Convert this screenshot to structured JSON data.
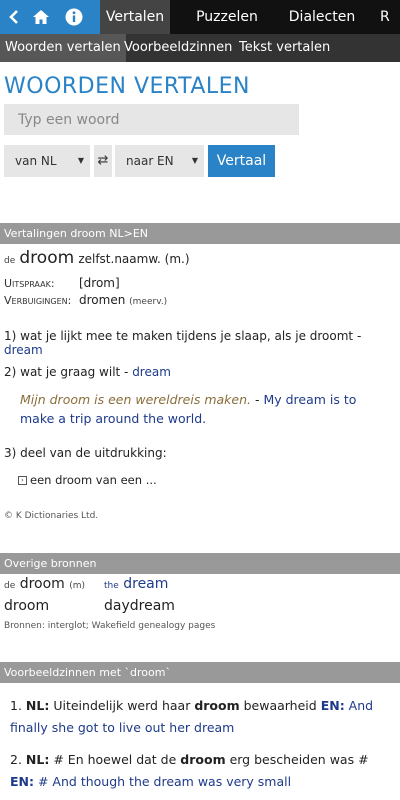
{
  "nav": {
    "back_icon": "chevron-left-icon",
    "home_icon": "home-icon",
    "info_icon": "info-icon",
    "tabs": [
      "Vertalen",
      "Puzzelen",
      "Dialecten",
      "R"
    ]
  },
  "subnav": [
    "Woorden vertalen",
    "Voorbeeldzinnen",
    "Tekst vertalen"
  ],
  "page_title": "WOORDEN VERTALEN",
  "search": {
    "placeholder": "Typ een woord"
  },
  "lang": {
    "from": "van NL",
    "to": "naar EN",
    "translate_button": "Vertaal"
  },
  "translations": {
    "header": "Vertalingen droom NL>EN",
    "article": "de",
    "word": "droom",
    "pos": "zelfst.naamw. (m.)",
    "pron_label": "Uitspraak:",
    "pron_value": "[drom]",
    "infl_label": "Verbuigingen:",
    "infl_value": "dromen",
    "infl_note": "(meerv.)",
    "senses": [
      {
        "text": "1) wat je lijkt mee te maken tijdens je slaap, als je droomt - ",
        "translation": "dream"
      },
      {
        "text": "2) wat je graag wilt - ",
        "translation": "dream"
      }
    ],
    "example_nl": "Mijn droom is een wereldreis maken.",
    "example_sep": " - ",
    "example_en": "My dream is to make a trip around the world.",
    "sense3": "3) deel van de uitdrukking:",
    "expression": "een droom van een ...",
    "copyright": "© K Dictionaries Ltd."
  },
  "other_sources": {
    "header": "Overige bronnen",
    "rows": [
      {
        "left_article": "de",
        "left": "droom",
        "left_note": "(m)",
        "right_article": "the",
        "right": "dream"
      },
      {
        "left_article": "",
        "left": "droom",
        "left_note": "",
        "right_article": "",
        "right": "daydream"
      }
    ],
    "sources": "Bronnen: interglot; Wakefield genealogy pages"
  },
  "example_sentences": {
    "header": "Voorbeeldzinnen met `droom`",
    "items": [
      {
        "num": "1.",
        "nl_label": "NL:",
        "nl_before": "Uiteindelijk werd haar ",
        "nl_bold": "droom",
        "nl_after": " bewaarheid ",
        "en_label": "EN:",
        "en": "And finally she got to live out her dream"
      },
      {
        "num": "2.",
        "nl_label": "NL:",
        "nl_before": "# En hoewel dat de ",
        "nl_bold": "droom",
        "nl_after": " erg bescheiden was # ",
        "en_label": "EN:",
        "en": "# And though the dream was very small"
      }
    ]
  },
  "colors": {
    "accent": "#2a83c6",
    "topbar": "#111111",
    "subbar": "#333333",
    "section_header": "#999999",
    "translation": "#1e3a8a"
  }
}
